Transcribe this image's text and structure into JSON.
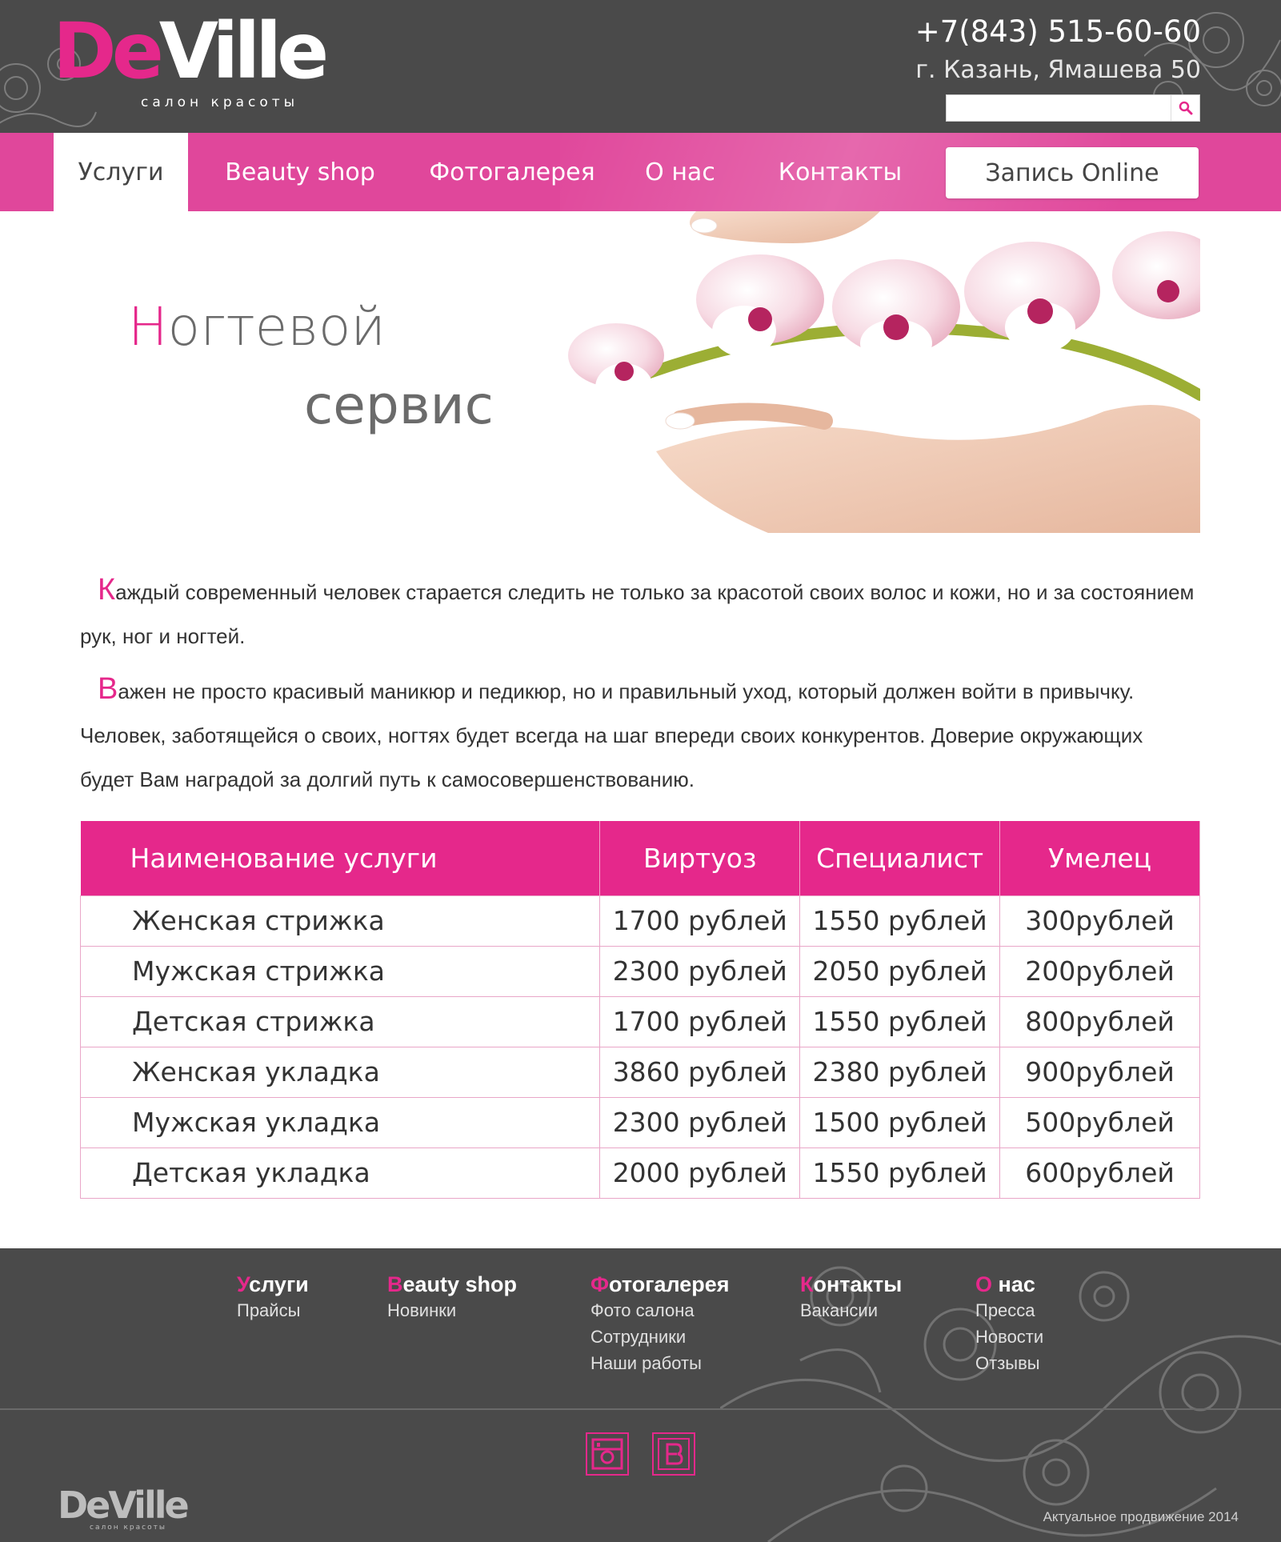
{
  "header": {
    "logo_main_pink": "De",
    "logo_main_white": "Ville",
    "logo_sub": "салон красоты",
    "phone": "+7(843) 515-60-60",
    "address": "г. Казань, Ямашева 50",
    "search_placeholder": "",
    "search_icon": "search-icon"
  },
  "nav": {
    "items": [
      {
        "label": "Услуги",
        "active": true
      },
      {
        "label": "Beauty shop",
        "active": false
      },
      {
        "label": "Фотогалерея",
        "active": false
      },
      {
        "label": "О нас",
        "active": false
      },
      {
        "label": "Контакты",
        "active": false
      }
    ],
    "record_button": "Запись Online"
  },
  "hero": {
    "title_first_letter": "Н",
    "title_line1_rest": "огтевой",
    "title_line2": "сервис"
  },
  "intro": {
    "p1_first_letter": "К",
    "p1_rest": "аждый современный человек старается следить не только за красотой своих волос и кожи, но и за состоянием рук, ног и ногтей.",
    "p2_first_letter": "В",
    "p2_rest": "ажен не просто  красивый маникюр и педикюр, но и правильный уход, который должен войти в привычку. Человек, заботящейся о своих, ногтях будет всегда на шаг впереди своих конкурентов. Доверие окружающих  будет Вам наградой за долгий путь к самосовершенствованию."
  },
  "table": {
    "headers": [
      "Наименование услуги",
      "Виртуоз",
      "Специалист",
      "Умелец"
    ],
    "rows": [
      [
        "Женская стрижка",
        "1700 рублей",
        "1550 рублей",
        "300рублей"
      ],
      [
        "Мужская стрижка",
        "2300 рублей",
        "2050 рублей",
        "200рублей"
      ],
      [
        "Детская стрижка",
        "1700 рублей",
        "1550 рублей",
        "800рублей"
      ],
      [
        "Женская укладка",
        "3860 рублей",
        "2380 рублей",
        "900рублей"
      ],
      [
        "Мужская укладка",
        "2300 рублей",
        "1500 рублей",
        "500рублей"
      ],
      [
        "Детская укладка",
        "2000 рублей",
        "1550 рублей",
        "600рублей"
      ]
    ]
  },
  "footer": {
    "columns": [
      {
        "title_first": "У",
        "title_rest": "слуги",
        "links": [
          "Прайсы"
        ]
      },
      {
        "title_first": "B",
        "title_rest": "eauty shop",
        "links": [
          "Новинки"
        ]
      },
      {
        "title_first": "Ф",
        "title_rest": "отогалерея",
        "links": [
          "Фото салона",
          "Сотрудники",
          "Наши работы"
        ]
      },
      {
        "title_first": "К",
        "title_rest": "онтакты",
        "links": [
          "Вакансии"
        ]
      },
      {
        "title_first": "О",
        "title_rest": " нас",
        "links": [
          "Пресса",
          "Новости",
          "Отзывы"
        ]
      }
    ],
    "social": [
      "instagram-icon",
      "vk-icon"
    ],
    "logo_text": "DeVille",
    "logo_sub": "салон красоты",
    "copyright": "Актуальное продвижение 2014"
  },
  "colors": {
    "accent": "#e5288b",
    "nav_bg": "#e0479b",
    "dark_bg": "#4a4a4a"
  }
}
